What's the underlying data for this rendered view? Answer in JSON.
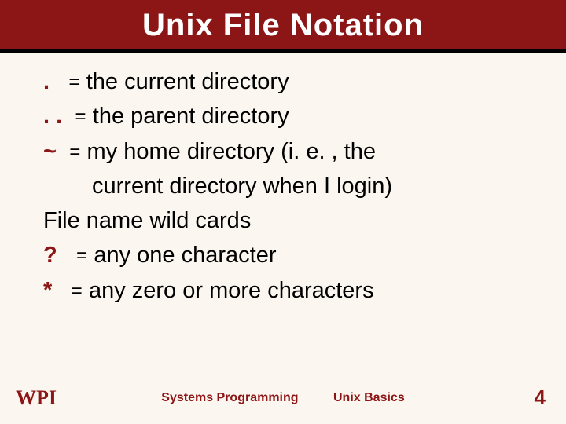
{
  "title": "Unix File Notation",
  "items": {
    "dot": {
      "symbol": ".",
      "eq": "=",
      "text": "the current directory"
    },
    "dotdot": {
      "symbol": ". .",
      "eq": "=",
      "text": "the parent directory"
    },
    "tilde": {
      "symbol": "~",
      "eq": "=",
      "text": "my home directory (i. e. , the",
      "text2": "current directory when I login)"
    },
    "wildcards": {
      "header": "File name wild cards"
    },
    "qmark": {
      "symbol": "?",
      "eq": "=",
      "text": "any one character"
    },
    "star": {
      "symbol": "*",
      "eq": "=",
      "text": "any zero or more characters"
    }
  },
  "footer": {
    "logo_text": "WPI",
    "course": "Systems Programming",
    "topic": "Unix Basics",
    "page": "4"
  }
}
